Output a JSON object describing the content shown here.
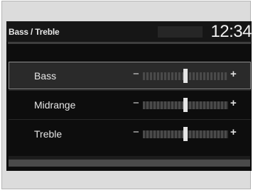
{
  "header": {
    "title": "Bass / Treble",
    "clock": "12:34"
  },
  "settings": {
    "selected": "bass",
    "rows": [
      {
        "id": "bass",
        "label": "Bass",
        "minus": "−",
        "plus": "+",
        "level": 0.5
      },
      {
        "id": "midrange",
        "label": "Midrange",
        "minus": "−",
        "plus": "+",
        "level": 0.5
      },
      {
        "id": "treble",
        "label": "Treble",
        "minus": "−",
        "plus": "+",
        "level": 0.5
      }
    ]
  },
  "colors": {
    "screen_bg": "#0d0d0d",
    "text": "#e6e6e6",
    "selection_border": "#8e8e8e"
  }
}
